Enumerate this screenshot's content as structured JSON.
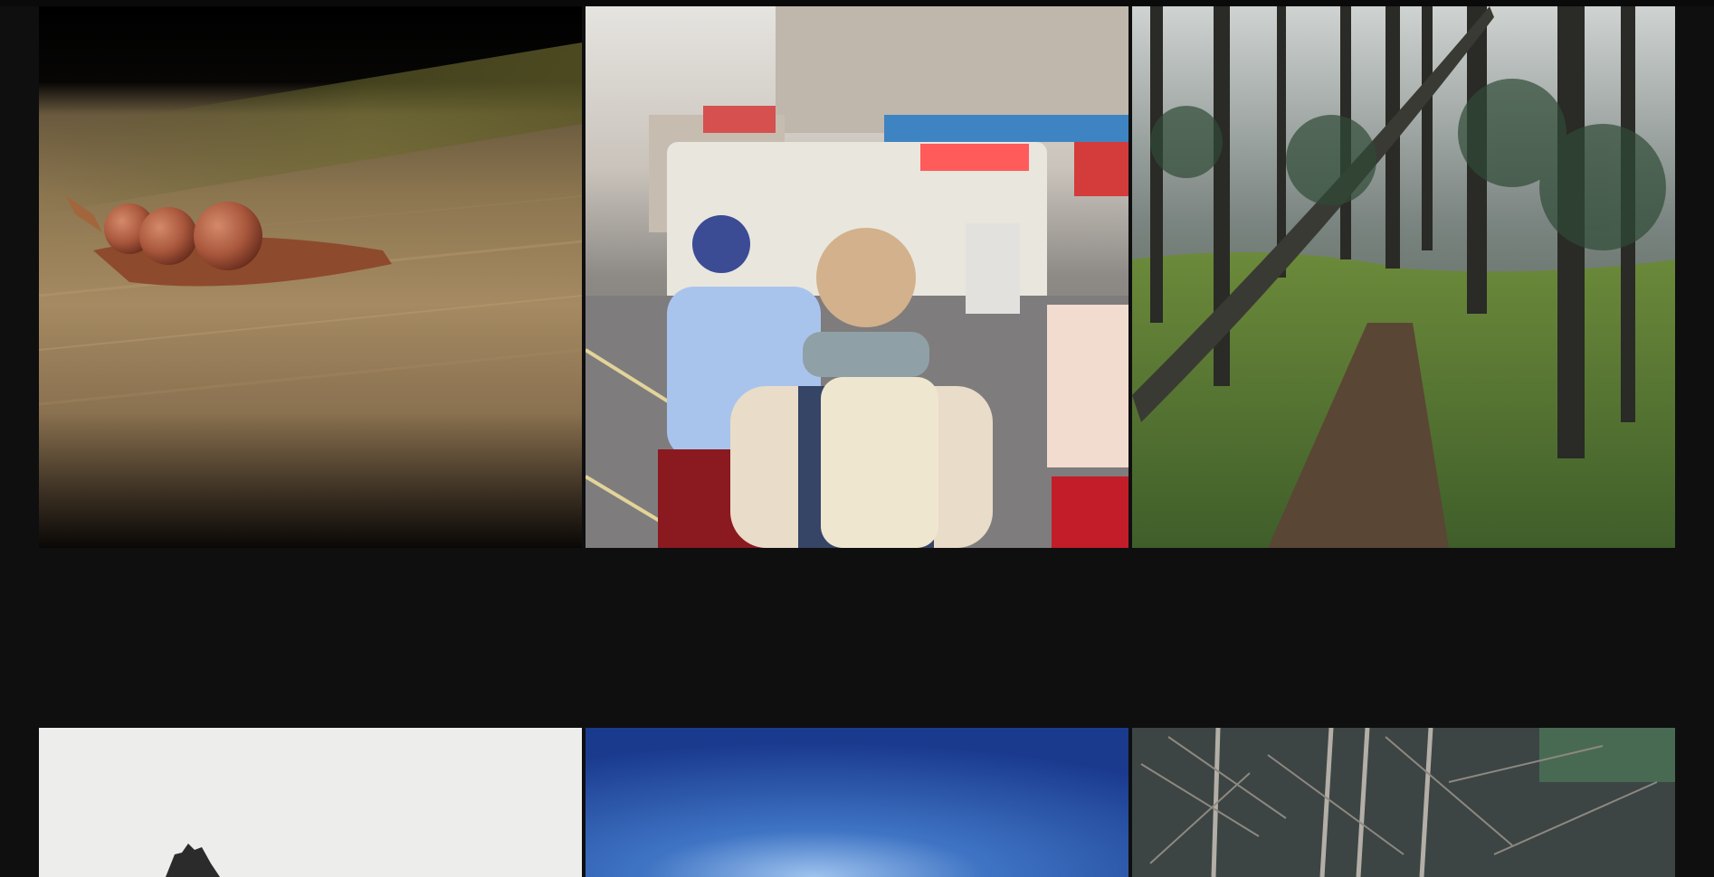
{
  "gallery": {
    "tiles": [
      {
        "subject": "acorns-on-wood-photo"
      },
      {
        "subject": "street-traffic-photo"
      },
      {
        "subject": "forest-trail-photo"
      },
      {
        "subject": "misty-rock-photo"
      },
      {
        "subject": "blue-sky-photo"
      },
      {
        "subject": "bare-branches-photo"
      }
    ]
  },
  "colors": {
    "background": "#0f0f10",
    "topbar": "#0a0a0a"
  }
}
